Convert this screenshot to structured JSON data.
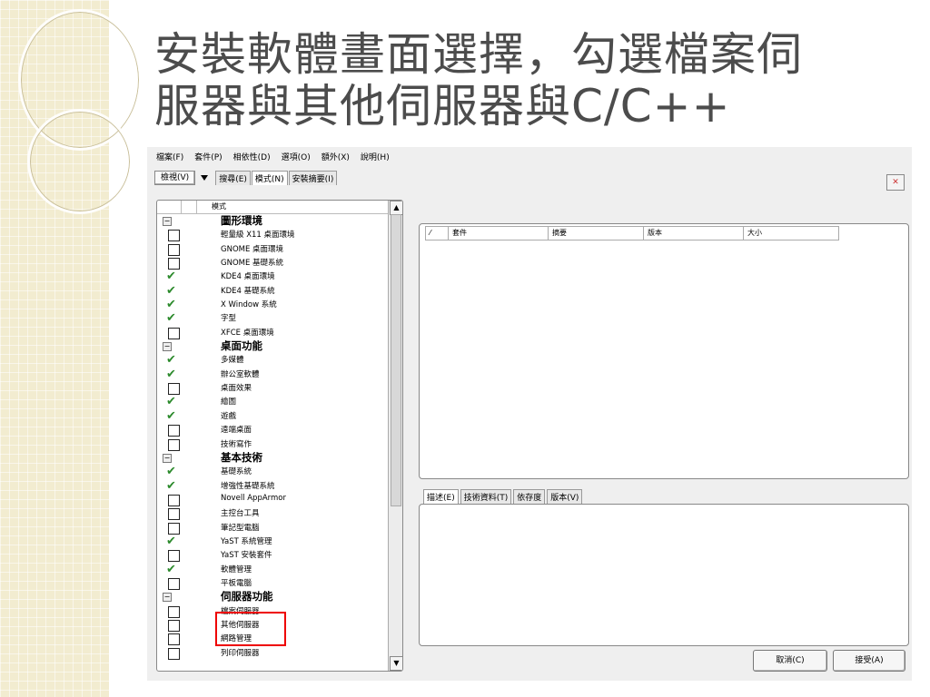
{
  "slide": {
    "title_line1": "安裝軟體畫面選擇，勾選檔案伺",
    "title_line2": "服器與其他伺服器與C/C++"
  },
  "app": {
    "menu": [
      "檔案(F)",
      "套件(P)",
      "相依性(D)",
      "選項(O)",
      "額外(X)",
      "說明(H)"
    ],
    "view_button": "檢視(V)",
    "tabs": [
      "搜尋(E)",
      "模式(N)",
      "安裝摘要(I)"
    ],
    "list_header": "模式",
    "items": [
      {
        "label": "圖形環境",
        "type": "group"
      },
      {
        "label": "輕量級 X11 桌面環境",
        "checked": false
      },
      {
        "label": "GNOME 桌面環境",
        "checked": false
      },
      {
        "label": "GNOME 基礎系統",
        "checked": false
      },
      {
        "label": "KDE4 桌面環境",
        "checked": true
      },
      {
        "label": "KDE4 基礎系統",
        "checked": true
      },
      {
        "label": "X Window 系統",
        "checked": true
      },
      {
        "label": "字型",
        "checked": true
      },
      {
        "label": "XFCE 桌面環境",
        "checked": false
      },
      {
        "label": "桌面功能",
        "type": "group"
      },
      {
        "label": "多媒體",
        "checked": true
      },
      {
        "label": "辦公室軟體",
        "checked": true
      },
      {
        "label": "桌面效果",
        "checked": false
      },
      {
        "label": "繪圖",
        "checked": true
      },
      {
        "label": "遊戲",
        "checked": true
      },
      {
        "label": "遠端桌面",
        "checked": false
      },
      {
        "label": "技術寫作",
        "checked": false
      },
      {
        "label": "基本技術",
        "type": "group"
      },
      {
        "label": "基礎系統",
        "checked": true
      },
      {
        "label": "增強性基礎系統",
        "checked": true
      },
      {
        "label": "Novell AppArmor",
        "checked": false
      },
      {
        "label": "主控台工具",
        "checked": false
      },
      {
        "label": "筆記型電腦",
        "checked": false
      },
      {
        "label": "YaST 系統管理",
        "checked": true
      },
      {
        "label": "YaST 安裝套件",
        "checked": false
      },
      {
        "label": "軟體管理",
        "checked": true
      },
      {
        "label": "平板電腦",
        "checked": false
      },
      {
        "label": "伺服器功能",
        "type": "group"
      },
      {
        "label": "檔案伺服器",
        "checked": false
      },
      {
        "label": "其他伺服器",
        "checked": false
      },
      {
        "label": "網路管理",
        "checked": false
      },
      {
        "label": "列印伺服器",
        "checked": false
      }
    ],
    "package_columns": [
      "套件",
      "摘要",
      "版本",
      "大小"
    ],
    "detail_tabs": [
      "描述(E)",
      "技術資料(T)",
      "依存度",
      "版本(V)"
    ],
    "buttons": {
      "cancel": "取消(C)",
      "accept": "接受(A)"
    }
  }
}
